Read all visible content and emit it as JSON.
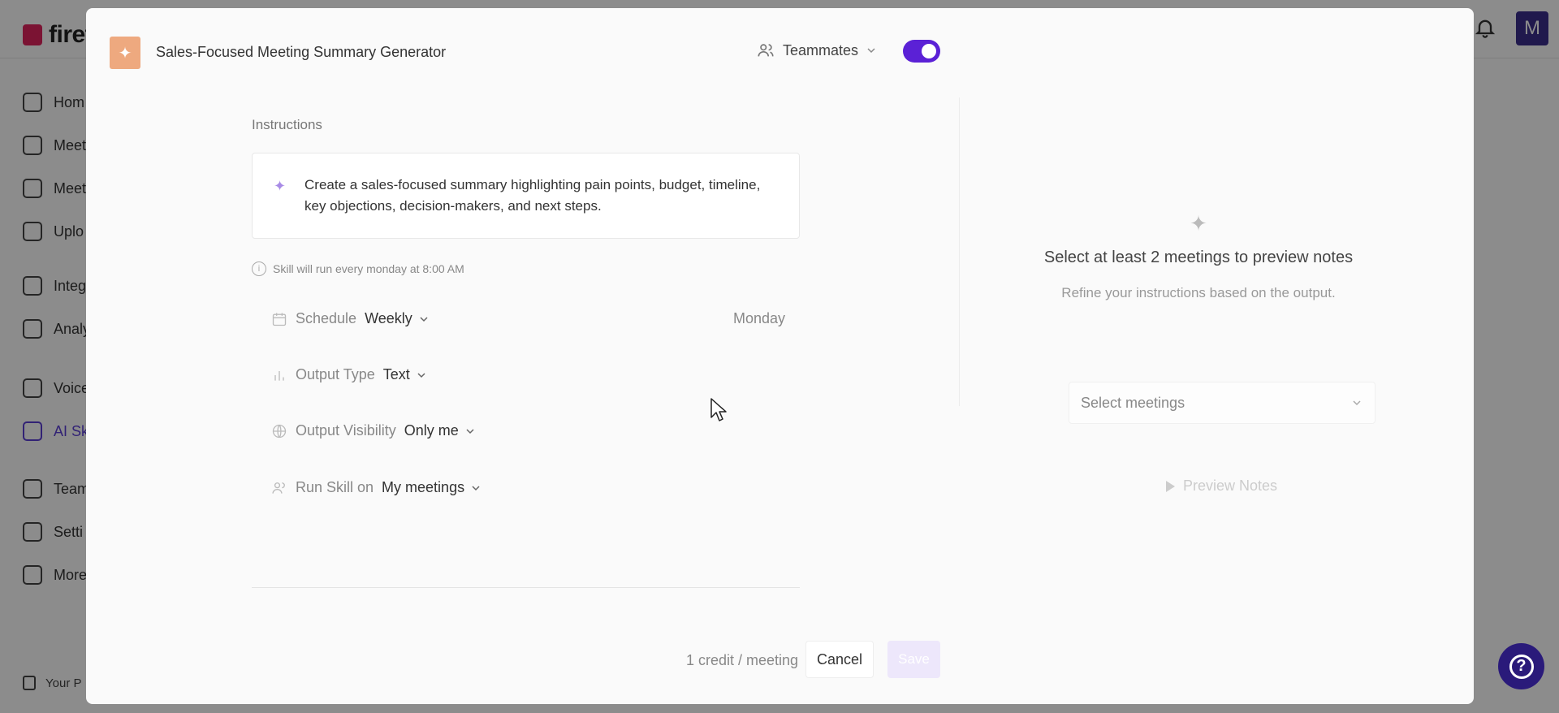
{
  "background": {
    "logo_text": "firef",
    "avatar_initial": "M",
    "nav": [
      {
        "label": "Hom",
        "icon": "home-icon"
      },
      {
        "label": "Meet",
        "icon": "video-icon"
      },
      {
        "label": "Meet",
        "icon": "pulse-icon"
      },
      {
        "label": "Uplo",
        "icon": "upload-icon"
      },
      {
        "label": "Integ",
        "icon": "layers-icon"
      },
      {
        "label": "Analy",
        "icon": "bar-chart-icon"
      },
      {
        "label": "Voice",
        "icon": "bot-icon"
      },
      {
        "label": "AI Sk",
        "icon": "sparkle-icon"
      },
      {
        "label": "Team",
        "icon": "users-icon"
      },
      {
        "label": "Setti",
        "icon": "gear-icon"
      },
      {
        "label": "More",
        "icon": "dots-icon"
      }
    ],
    "footer_text": "Your P"
  },
  "modal": {
    "title": "Sales-Focused Meeting Summary Generator",
    "teammates_label": "Teammates",
    "toggle_on": true,
    "instructions_label": "Instructions",
    "instructions_text": "Create a sales-focused summary highlighting pain points, budget, timeline, key objections, decision-makers, and next steps.",
    "schedule_note": "Skill will run every monday at 8:00 AM",
    "options": {
      "schedule": {
        "label": "Schedule",
        "value": "Weekly",
        "day": "Monday"
      },
      "output_type": {
        "label": "Output Type",
        "value": "Text"
      },
      "output_visibility": {
        "label": "Output Visibility",
        "value": "Only me"
      },
      "run_skill_on": {
        "label": "Run Skill on",
        "value": "My meetings"
      }
    },
    "credit_text": "1 credit / meeting",
    "cancel_label": "Cancel",
    "save_label": "Save",
    "preview": {
      "title": "Select at least 2 meetings to preview notes",
      "subtitle": "Refine your instructions based on the output.",
      "select_placeholder": "Select meetings",
      "button_label": "Preview Notes"
    }
  },
  "colors": {
    "accent": "#5b21d6",
    "skill_icon": "#eea97f",
    "help_fab": "#2a1a7a"
  }
}
